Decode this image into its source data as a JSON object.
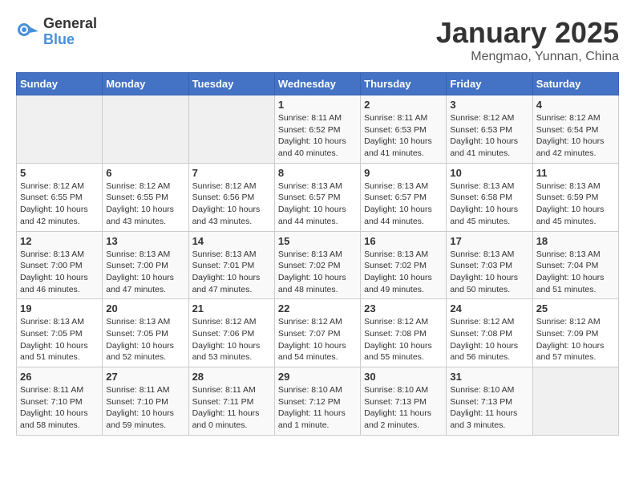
{
  "header": {
    "logo_general": "General",
    "logo_blue": "Blue",
    "title": "January 2025",
    "subtitle": "Mengmao, Yunnan, China"
  },
  "calendar": {
    "days_of_week": [
      "Sunday",
      "Monday",
      "Tuesday",
      "Wednesday",
      "Thursday",
      "Friday",
      "Saturday"
    ],
    "weeks": [
      [
        {
          "day": "",
          "info": ""
        },
        {
          "day": "",
          "info": ""
        },
        {
          "day": "",
          "info": ""
        },
        {
          "day": "1",
          "info": "Sunrise: 8:11 AM\nSunset: 6:52 PM\nDaylight: 10 hours\nand 40 minutes."
        },
        {
          "day": "2",
          "info": "Sunrise: 8:11 AM\nSunset: 6:53 PM\nDaylight: 10 hours\nand 41 minutes."
        },
        {
          "day": "3",
          "info": "Sunrise: 8:12 AM\nSunset: 6:53 PM\nDaylight: 10 hours\nand 41 minutes."
        },
        {
          "day": "4",
          "info": "Sunrise: 8:12 AM\nSunset: 6:54 PM\nDaylight: 10 hours\nand 42 minutes."
        }
      ],
      [
        {
          "day": "5",
          "info": "Sunrise: 8:12 AM\nSunset: 6:55 PM\nDaylight: 10 hours\nand 42 minutes."
        },
        {
          "day": "6",
          "info": "Sunrise: 8:12 AM\nSunset: 6:55 PM\nDaylight: 10 hours\nand 43 minutes."
        },
        {
          "day": "7",
          "info": "Sunrise: 8:12 AM\nSunset: 6:56 PM\nDaylight: 10 hours\nand 43 minutes."
        },
        {
          "day": "8",
          "info": "Sunrise: 8:13 AM\nSunset: 6:57 PM\nDaylight: 10 hours\nand 44 minutes."
        },
        {
          "day": "9",
          "info": "Sunrise: 8:13 AM\nSunset: 6:57 PM\nDaylight: 10 hours\nand 44 minutes."
        },
        {
          "day": "10",
          "info": "Sunrise: 8:13 AM\nSunset: 6:58 PM\nDaylight: 10 hours\nand 45 minutes."
        },
        {
          "day": "11",
          "info": "Sunrise: 8:13 AM\nSunset: 6:59 PM\nDaylight: 10 hours\nand 45 minutes."
        }
      ],
      [
        {
          "day": "12",
          "info": "Sunrise: 8:13 AM\nSunset: 7:00 PM\nDaylight: 10 hours\nand 46 minutes."
        },
        {
          "day": "13",
          "info": "Sunrise: 8:13 AM\nSunset: 7:00 PM\nDaylight: 10 hours\nand 47 minutes."
        },
        {
          "day": "14",
          "info": "Sunrise: 8:13 AM\nSunset: 7:01 PM\nDaylight: 10 hours\nand 47 minutes."
        },
        {
          "day": "15",
          "info": "Sunrise: 8:13 AM\nSunset: 7:02 PM\nDaylight: 10 hours\nand 48 minutes."
        },
        {
          "day": "16",
          "info": "Sunrise: 8:13 AM\nSunset: 7:02 PM\nDaylight: 10 hours\nand 49 minutes."
        },
        {
          "day": "17",
          "info": "Sunrise: 8:13 AM\nSunset: 7:03 PM\nDaylight: 10 hours\nand 50 minutes."
        },
        {
          "day": "18",
          "info": "Sunrise: 8:13 AM\nSunset: 7:04 PM\nDaylight: 10 hours\nand 51 minutes."
        }
      ],
      [
        {
          "day": "19",
          "info": "Sunrise: 8:13 AM\nSunset: 7:05 PM\nDaylight: 10 hours\nand 51 minutes."
        },
        {
          "day": "20",
          "info": "Sunrise: 8:13 AM\nSunset: 7:05 PM\nDaylight: 10 hours\nand 52 minutes."
        },
        {
          "day": "21",
          "info": "Sunrise: 8:12 AM\nSunset: 7:06 PM\nDaylight: 10 hours\nand 53 minutes."
        },
        {
          "day": "22",
          "info": "Sunrise: 8:12 AM\nSunset: 7:07 PM\nDaylight: 10 hours\nand 54 minutes."
        },
        {
          "day": "23",
          "info": "Sunrise: 8:12 AM\nSunset: 7:08 PM\nDaylight: 10 hours\nand 55 minutes."
        },
        {
          "day": "24",
          "info": "Sunrise: 8:12 AM\nSunset: 7:08 PM\nDaylight: 10 hours\nand 56 minutes."
        },
        {
          "day": "25",
          "info": "Sunrise: 8:12 AM\nSunset: 7:09 PM\nDaylight: 10 hours\nand 57 minutes."
        }
      ],
      [
        {
          "day": "26",
          "info": "Sunrise: 8:11 AM\nSunset: 7:10 PM\nDaylight: 10 hours\nand 58 minutes."
        },
        {
          "day": "27",
          "info": "Sunrise: 8:11 AM\nSunset: 7:10 PM\nDaylight: 10 hours\nand 59 minutes."
        },
        {
          "day": "28",
          "info": "Sunrise: 8:11 AM\nSunset: 7:11 PM\nDaylight: 11 hours\nand 0 minutes."
        },
        {
          "day": "29",
          "info": "Sunrise: 8:10 AM\nSunset: 7:12 PM\nDaylight: 11 hours\nand 1 minute."
        },
        {
          "day": "30",
          "info": "Sunrise: 8:10 AM\nSunset: 7:13 PM\nDaylight: 11 hours\nand 2 minutes."
        },
        {
          "day": "31",
          "info": "Sunrise: 8:10 AM\nSunset: 7:13 PM\nDaylight: 11 hours\nand 3 minutes."
        },
        {
          "day": "",
          "info": ""
        }
      ]
    ]
  }
}
